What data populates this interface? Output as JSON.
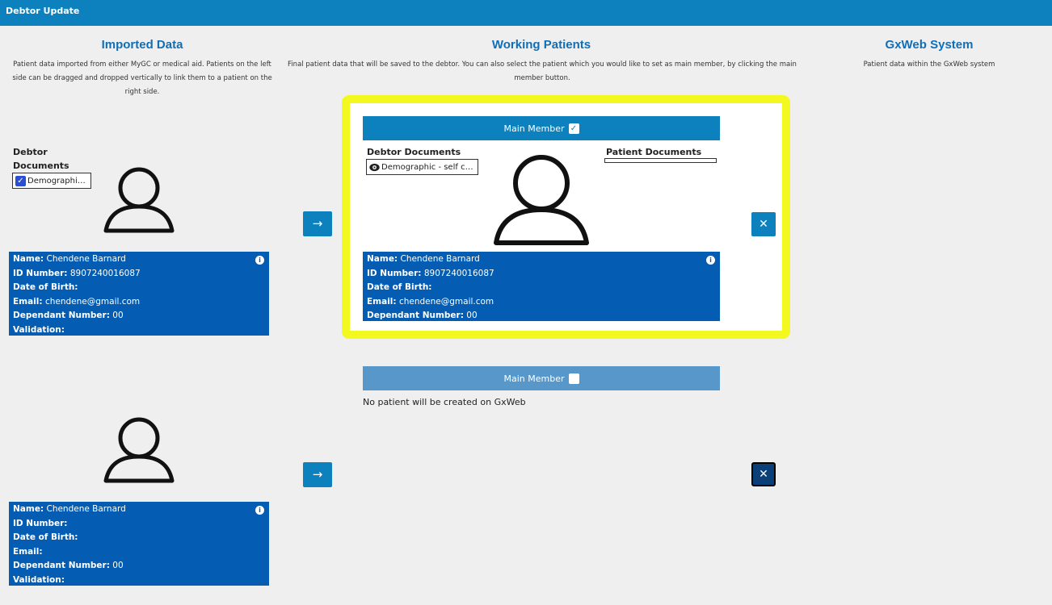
{
  "app": {
    "title": "Debtor Update"
  },
  "columns": {
    "imported": {
      "title": "Imported Data",
      "description": "Patient data imported from either MyGC or medical aid. Patients on the left side can be dragged and dropped vertically to link them to a patient on the right side."
    },
    "working": {
      "title": "Working Patients",
      "description": "Final patient data that will be saved to the debtor. You can also select the patient which you would like to set as main member, by clicking the main member button."
    },
    "gxweb": {
      "title": "GxWeb System",
      "description": "Patient data within the GxWeb system"
    }
  },
  "imported_patients": [
    {
      "debtor_documents_label": "Debtor Documents",
      "document_chip": "Demographi…",
      "name_label": "Name:",
      "name": "Chendene Barnard",
      "id_label": "ID Number:",
      "id": "8907240016087",
      "dob_label": "Date of Birth:",
      "dob": "",
      "email_label": "Email:",
      "email": "chendene@gmail.com",
      "dependant_label": "Dependant Number:",
      "dependant": "00",
      "validation_label": "Validation:",
      "validation": ""
    },
    {
      "name_label": "Name:",
      "name": "Chendene Barnard",
      "id_label": "ID Number:",
      "id": "",
      "dob_label": "Date of Birth:",
      "dob": "",
      "email_label": "Email:",
      "email": "",
      "dependant_label": "Dependant Number:",
      "dependant": "00",
      "validation_label": "Validation:",
      "validation": ""
    }
  ],
  "working_patients": [
    {
      "main_member_label": "Main Member",
      "main_member_checked": true,
      "debtor_documents_label": "Debtor Documents",
      "patient_documents_label": "Patient Documents",
      "document_chip": "Demographic - self c…",
      "name_label": "Name:",
      "name": "Chendene Barnard",
      "id_label": "ID Number:",
      "id": "8907240016087",
      "dob_label": "Date of Birth:",
      "dob": "",
      "email_label": "Email:",
      "email": "chendene@gmail.com",
      "dependant_label": "Dependant Number:",
      "dependant": "00"
    },
    {
      "main_member_label": "Main Member",
      "main_member_checked": false,
      "no_patient_text": "No patient will be created on GxWeb"
    }
  ],
  "icons": {
    "arrow": "→",
    "close": "✕",
    "info": "i",
    "check": "✓",
    "eye": "eye-icon"
  },
  "colors": {
    "header": "#0c81bd",
    "info_box": "#045db3",
    "highlight": "#f3f91f",
    "title": "#0f6eb6"
  }
}
